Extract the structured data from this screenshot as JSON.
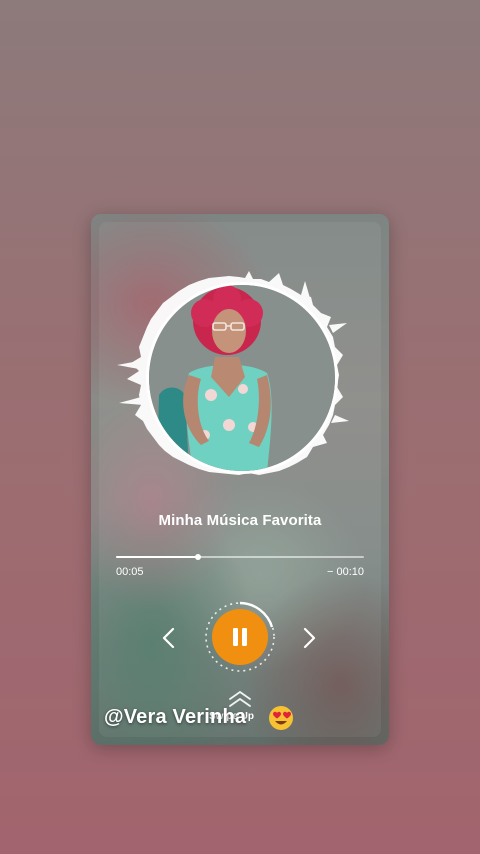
{
  "player": {
    "song_title": "Minha Música Favorita",
    "time_elapsed": "00:05",
    "time_remaining": "− 00:10",
    "progress": 0.33,
    "state": "playing",
    "accent_color": "#f18f11",
    "icons": {
      "prev": "chevron-left-icon",
      "next": "chevron-right-icon",
      "play_pause": "pause-icon",
      "swipe": "chevrons-up-icon"
    },
    "swipe_label": "Swipe Up"
  },
  "overlay": {
    "handle": "@Vera  Verinha",
    "emoji": "heart-eyes-emoji"
  }
}
